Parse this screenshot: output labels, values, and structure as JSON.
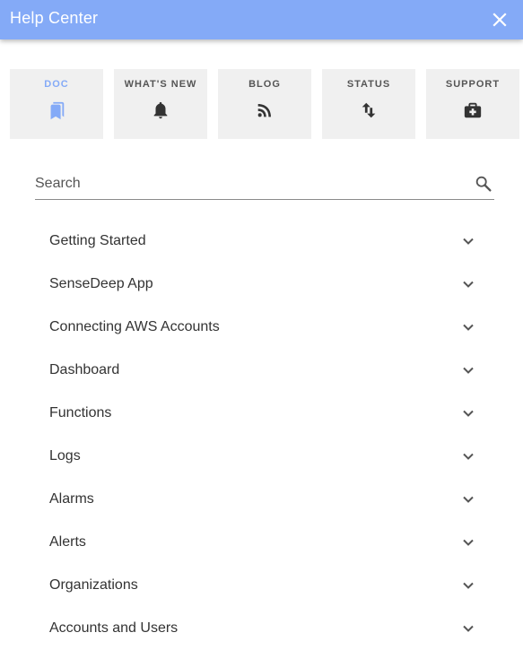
{
  "header": {
    "title": "Help Center",
    "close_icon": "close-icon"
  },
  "accent_color": "#84aaf7",
  "tabs": [
    {
      "label": "DOC",
      "icon": "bookmarks-icon",
      "active": true
    },
    {
      "label": "WHAT'S NEW",
      "icon": "bell-icon",
      "active": false
    },
    {
      "label": "BLOG",
      "icon": "rss-icon",
      "active": false
    },
    {
      "label": "STATUS",
      "icon": "swap-vertical-icon",
      "active": false
    },
    {
      "label": "SUPPORT",
      "icon": "medical-bag-icon",
      "active": false
    }
  ],
  "search": {
    "placeholder": "Search",
    "value": "",
    "icon": "search-icon"
  },
  "topics": [
    {
      "label": "Getting Started"
    },
    {
      "label": "SenseDeep App"
    },
    {
      "label": "Connecting AWS Accounts"
    },
    {
      "label": "Dashboard"
    },
    {
      "label": "Functions"
    },
    {
      "label": "Logs"
    },
    {
      "label": "Alarms"
    },
    {
      "label": "Alerts"
    },
    {
      "label": "Organizations"
    },
    {
      "label": "Accounts and Users"
    }
  ]
}
